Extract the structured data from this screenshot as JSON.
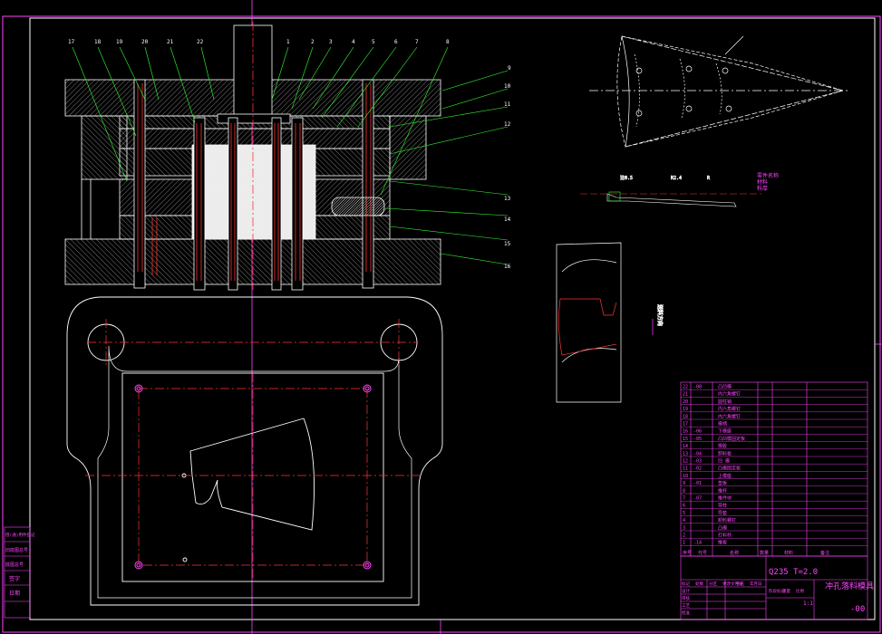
{
  "drawing": {
    "part_no": "-00",
    "part_no_left": "-00",
    "material_code": "Q235 T=2.0",
    "title": "冲孔落料模具",
    "callouts_top": [
      "17",
      "18",
      "19",
      "20",
      "21",
      "22",
      "1",
      "2",
      "3",
      "4",
      "5",
      "6",
      "7",
      "8"
    ],
    "callouts_right": [
      "9",
      "10",
      "11",
      "12",
      "13",
      "14",
      "15",
      "16"
    ],
    "bom_rows": [
      {
        "no": "22",
        "code": "-08",
        "name": "凸凹模"
      },
      {
        "no": "21",
        "code": "",
        "name": "内六角螺钉"
      },
      {
        "no": "20",
        "code": "",
        "name": "圆柱销"
      },
      {
        "no": "19",
        "code": "",
        "name": "内六角螺钉"
      },
      {
        "no": "18",
        "code": "",
        "name": "内六角螺钉"
      },
      {
        "no": "17",
        "code": "",
        "name": "模柄"
      },
      {
        "no": "16",
        "code": "-06",
        "name": "下模座"
      },
      {
        "no": "15",
        "code": "-05",
        "name": "凸凹模固定板"
      },
      {
        "no": "14",
        "code": "",
        "name": "橡胶"
      },
      {
        "no": "13",
        "code": "-04",
        "name": "卸料板"
      },
      {
        "no": "12",
        "code": "-03",
        "name": "凹 模"
      },
      {
        "no": "11",
        "code": "-02",
        "name": "凸模固定板"
      },
      {
        "no": "10",
        "code": "",
        "name": "上模座"
      },
      {
        "no": "9",
        "code": "-01",
        "name": "垫板"
      },
      {
        "no": "8",
        "code": "",
        "name": "推杆"
      },
      {
        "no": "7",
        "code": "-07",
        "name": "推件块"
      },
      {
        "no": "6",
        "code": "",
        "name": "导柱"
      },
      {
        "no": "5",
        "code": "",
        "name": "导套"
      },
      {
        "no": "4",
        "code": "",
        "name": "卸料螺钉"
      },
      {
        "no": "3",
        "code": "",
        "name": "凸模"
      },
      {
        "no": "2",
        "code": "",
        "name": "打料杆"
      },
      {
        "no": "1",
        "code": "-14",
        "name": "推板"
      }
    ],
    "bom_header": [
      "序号",
      "代号",
      "名称",
      "数量",
      "材料",
      "备注"
    ],
    "left_stamp": [
      "借(通)用件登记",
      "旧底图总号",
      "底图总号",
      "签字",
      "日期"
    ],
    "title_block_labels": [
      "标记",
      "处数",
      "分区",
      "更改文件号",
      "签名",
      "年月日",
      "设计",
      "审核",
      "工艺",
      "批准",
      "阶段标记",
      "重量",
      "比例"
    ],
    "scale": "1:1",
    "notes": [
      "零件名称",
      "材料",
      "料厚"
    ]
  }
}
